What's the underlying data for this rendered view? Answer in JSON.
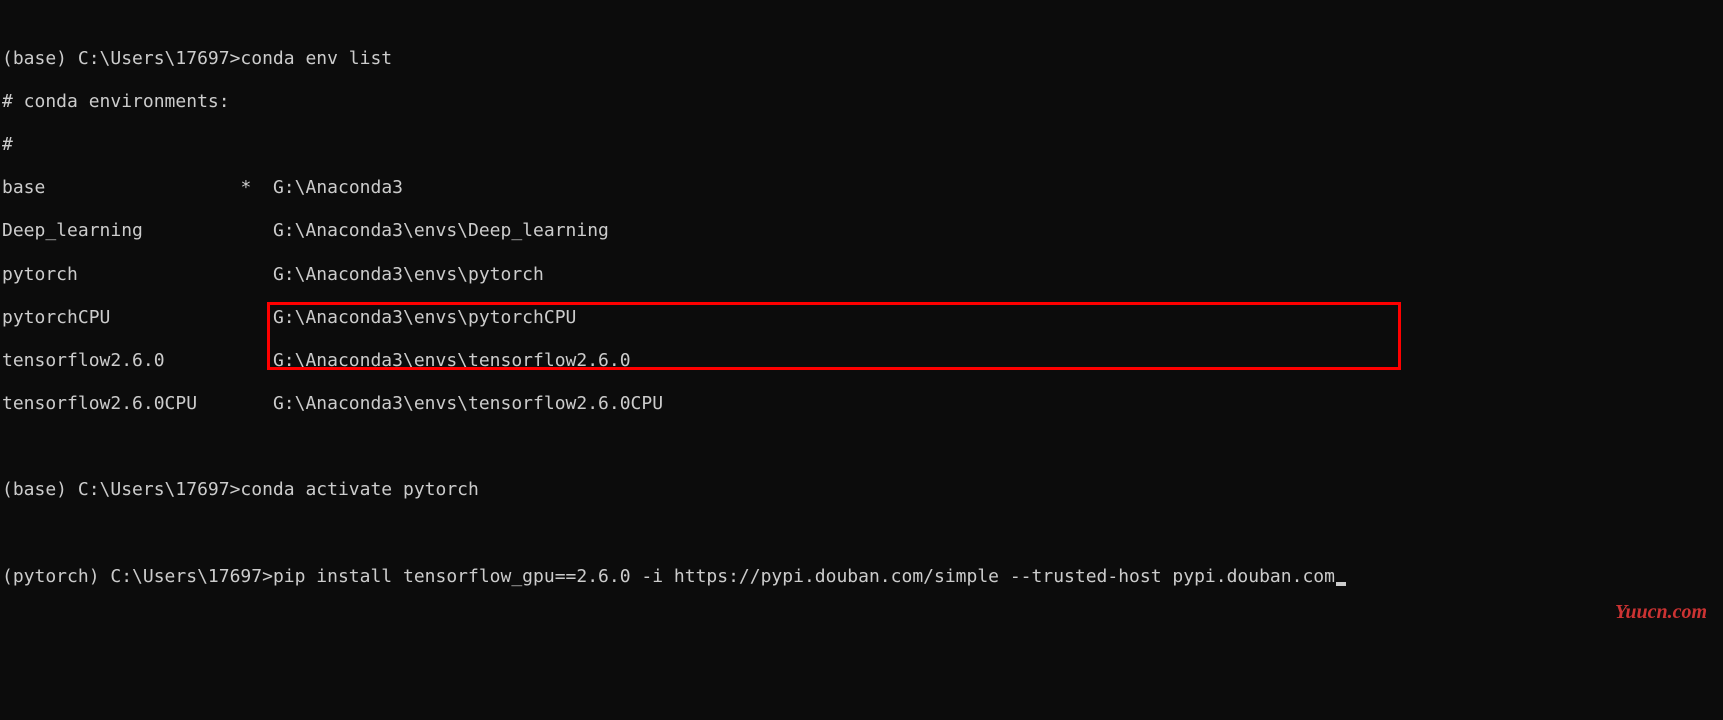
{
  "lines": {
    "l1_prompt": "(base) C:\\Users\\17697>",
    "l1_cmd": "conda env list",
    "l2": "# conda environments:",
    "l3": "#",
    "env1_name": "base",
    "env1_active": "*",
    "env1_path": "G:\\Anaconda3",
    "env2_name": "Deep_learning",
    "env2_path": "G:\\Anaconda3\\envs\\Deep_learning",
    "env3_name": "pytorch",
    "env3_path": "G:\\Anaconda3\\envs\\pytorch",
    "env4_name": "pytorchCPU",
    "env4_path": "G:\\Anaconda3\\envs\\pytorchCPU",
    "env5_name": "tensorflow2.6.0",
    "env5_path": "G:\\Anaconda3\\envs\\tensorflow2.6.0",
    "env6_name": "tensorflow2.6.0CPU",
    "env6_path": "G:\\Anaconda3\\envs\\tensorflow2.6.0CPU",
    "l11_prompt": "(base) C:\\Users\\17697>",
    "l11_cmd": "conda activate pytorch",
    "l13_prompt": "(pytorch) C:\\Users\\17697>",
    "l13_cmd": "pip install tensorflow_gpu==2.6.0 -i https://pypi.douban.com/simple --trusted-host pypi.douban.com"
  },
  "watermark": "Yuucn.com"
}
